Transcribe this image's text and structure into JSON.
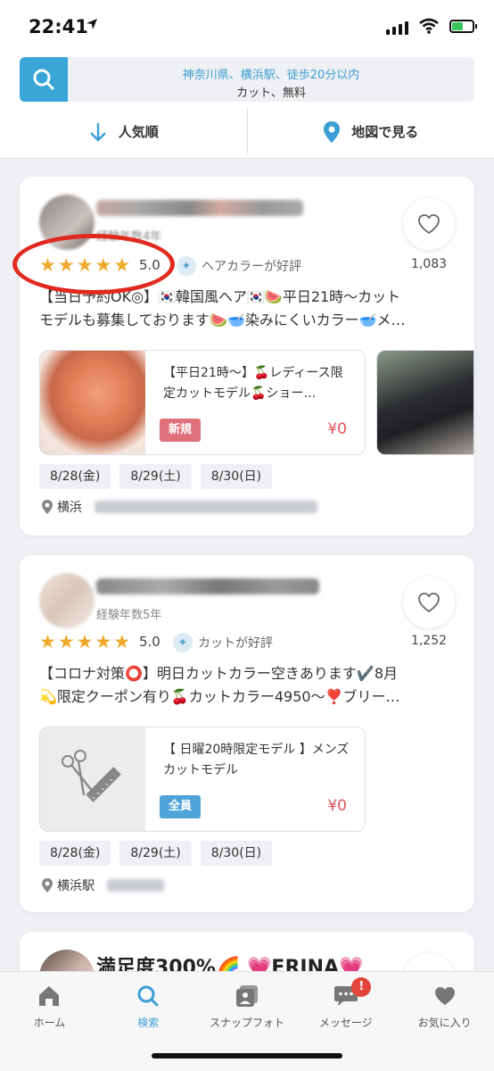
{
  "status": {
    "time": "22:41"
  },
  "search": {
    "line1": "神奈川県、横浜駅、徒歩20分以内",
    "line2": "カット、無料"
  },
  "sort": {
    "popular_label": "人気順",
    "map_label": "地図で見る"
  },
  "cards": [
    {
      "experience": "経験年数4年",
      "rating": "5.0",
      "stars": 5,
      "tag": "ヘアカラーが好評",
      "likes": "1,083",
      "description": [
        "【当日予約OK◎】🇰🇷韓国風ヘア🇰🇷🍉平日21時〜カット",
        "モデルも募集しております🍉🥣染みにくいカラー🥣メ…"
      ],
      "coupon": {
        "title": "【平日21時〜】🍒レディース限定カットモデル🍒ショー…",
        "badge": "新規",
        "price": "¥0"
      },
      "dates": [
        "8/28(金)",
        "8/29(土)",
        "8/30(日)"
      ],
      "location": "横浜"
    },
    {
      "experience": "経験年数5年",
      "rating": "5.0",
      "stars": 5,
      "tag": "カットが好評",
      "likes": "1,252",
      "description": [
        "【コロナ対策⭕】明日カットカラー空きあります✔️8月",
        "💫限定クーポン有り🍒カットカラー4950〜❣️ブリー…"
      ],
      "coupon": {
        "title": "【 日曜20時限定モデル 】メンズカットモデル",
        "badge": "全員",
        "price": "¥0"
      },
      "dates": [
        "8/28(金)",
        "8/29(土)",
        "8/30(日)"
      ],
      "location": "横浜駅"
    },
    {
      "name": "満足度300%🌈 💗ERINA💗"
    }
  ],
  "tabs": [
    {
      "label": "ホーム",
      "icon": "home-icon"
    },
    {
      "label": "検索",
      "icon": "search-icon"
    },
    {
      "label": "スナップフォト",
      "icon": "photo-icon"
    },
    {
      "label": "メッセージ",
      "icon": "message-icon",
      "badge": "!"
    },
    {
      "label": "お気に入り",
      "icon": "heart-icon"
    }
  ],
  "colors": {
    "accent": "#3aa6d8",
    "price": "#e0535b",
    "star": "#f0a92d",
    "new_badge": "#e0707a",
    "all_badge": "#4ea4d8",
    "highlight": "#e12a1f"
  }
}
